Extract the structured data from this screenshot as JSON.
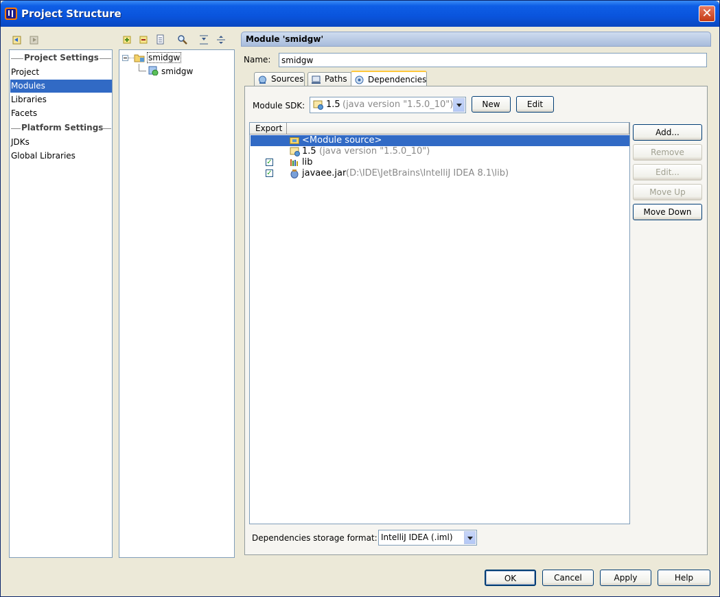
{
  "window": {
    "title": "Project Structure",
    "close_glyph": "✕"
  },
  "sidebar": {
    "project_settings_header": "Project Settings",
    "platform_settings_header": "Platform Settings",
    "items": [
      "Project",
      "Modules",
      "Libraries",
      "Facets",
      "JDKs",
      "Global Libraries"
    ],
    "selected": "Modules"
  },
  "tree": {
    "root": "smidgw",
    "child": "smidgw"
  },
  "module": {
    "header": "Module 'smidgw'",
    "name_label": "Name:",
    "name_value": "smidgw",
    "tabs": [
      "Sources",
      "Paths",
      "Dependencies"
    ],
    "active_tab": "Dependencies",
    "sdk_label": "Module SDK:",
    "sdk_value_version": "1.5",
    "sdk_value_detail": "(java version \"1.5.0_10\")",
    "new_button": "New",
    "edit_button": "Edit"
  },
  "dependencies": {
    "column_export": "Export",
    "rows": [
      {
        "name": "<Module source>",
        "detail": "",
        "checked": false,
        "selected": true
      },
      {
        "name": "1.5",
        "detail": "(java version \"1.5.0_10\")",
        "checked": false
      },
      {
        "name": "lib",
        "detail": "",
        "checked": true
      },
      {
        "name": "javaee.jar",
        "detail": "(D:\\IDE\\JetBrains\\IntelliJ IDEA 8.1\\lib)",
        "checked": true
      }
    ],
    "buttons": {
      "add": "Add...",
      "remove": "Remove",
      "edit": "Edit...",
      "move_up": "Move Up",
      "move_down": "Move Down"
    },
    "storage_label": "Dependencies storage format:",
    "storage_value": "IntelliJ IDEA (.iml)"
  },
  "footer": {
    "ok": "OK",
    "cancel": "Cancel",
    "apply": "Apply",
    "help": "Help"
  },
  "colors": {
    "selection": "#316ac5",
    "window_bg": "#ece9d8",
    "titlebar": "#0a54dc"
  }
}
